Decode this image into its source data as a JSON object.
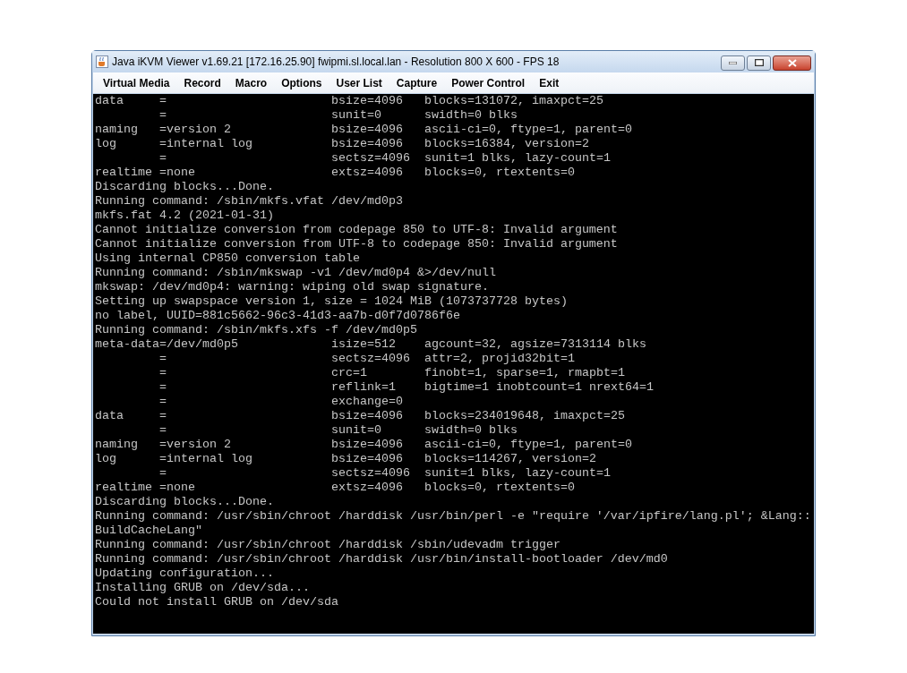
{
  "window": {
    "title": "Java iKVM Viewer v1.69.21 [172.16.25.90] fwipmi.sl.local.lan - Resolution 800 X 600 - FPS 18"
  },
  "menu": [
    "Virtual Media",
    "Record",
    "Macro",
    "Options",
    "User List",
    "Capture",
    "Power Control",
    "Exit"
  ],
  "console": [
    {
      "kind": "field",
      "label": "data",
      "value": "=",
      "param": "bsize=4096",
      "detail": "blocks=131072, imaxpct=25"
    },
    {
      "kind": "field",
      "value": "=",
      "param": "sunit=0",
      "detail": "swidth=0 blks"
    },
    {
      "kind": "field",
      "label": "naming",
      "value": "=version 2",
      "param": "bsize=4096",
      "detail": "ascii-ci=0, ftype=1, parent=0"
    },
    {
      "kind": "field",
      "label": "log",
      "value": "=internal log",
      "param": "bsize=4096",
      "detail": "blocks=16384, version=2"
    },
    {
      "kind": "field",
      "value": "=",
      "param": "sectsz=4096",
      "detail": "sunit=1 blks, lazy-count=1"
    },
    {
      "kind": "field",
      "label": "realtime",
      "value": "=none",
      "param": "extsz=4096",
      "detail": "blocks=0, rtextents=0"
    },
    {
      "kind": "text",
      "text": "Discarding blocks...Done."
    },
    {
      "kind": "text",
      "text": "Running command: /sbin/mkfs.vfat /dev/md0p3"
    },
    {
      "kind": "text",
      "text": "mkfs.fat 4.2 (2021-01-31)"
    },
    {
      "kind": "text",
      "text": "Cannot initialize conversion from codepage 850 to UTF-8: Invalid argument"
    },
    {
      "kind": "text",
      "text": "Cannot initialize conversion from UTF-8 to codepage 850: Invalid argument"
    },
    {
      "kind": "text",
      "text": "Using internal CP850 conversion table"
    },
    {
      "kind": "text",
      "text": "Running command: /sbin/mkswap -v1 /dev/md0p4 &>/dev/null"
    },
    {
      "kind": "text",
      "text": "mkswap: /dev/md0p4: warning: wiping old swap signature."
    },
    {
      "kind": "text",
      "text": "Setting up swapspace version 1, size = 1024 MiB (1073737728 bytes)"
    },
    {
      "kind": "text",
      "text": "no label, UUID=881c5662-96c3-41d3-aa7b-d0f7d0786f6e"
    },
    {
      "kind": "text",
      "text": "Running command: /sbin/mkfs.xfs -f /dev/md0p5"
    },
    {
      "kind": "field",
      "label": "meta-data",
      "value": "=/dev/md0p5",
      "param": "isize=512",
      "detail": "agcount=32, agsize=7313114 blks"
    },
    {
      "kind": "field",
      "value": "=",
      "param": "sectsz=4096",
      "detail": "attr=2, projid32bit=1"
    },
    {
      "kind": "field",
      "value": "=",
      "param": "crc=1",
      "detail": "finobt=1, sparse=1, rmapbt=1"
    },
    {
      "kind": "field",
      "value": "=",
      "param": "reflink=1",
      "detail": "bigtime=1 inobtcount=1 nrext64=1"
    },
    {
      "kind": "field",
      "value": "=",
      "param": "exchange=0"
    },
    {
      "kind": "field",
      "label": "data",
      "value": "=",
      "param": "bsize=4096",
      "detail": "blocks=234019648, imaxpct=25"
    },
    {
      "kind": "field",
      "value": "=",
      "param": "sunit=0",
      "detail": "swidth=0 blks"
    },
    {
      "kind": "field",
      "label": "naming",
      "value": "=version 2",
      "param": "bsize=4096",
      "detail": "ascii-ci=0, ftype=1, parent=0"
    },
    {
      "kind": "field",
      "label": "log",
      "value": "=internal log",
      "param": "bsize=4096",
      "detail": "blocks=114267, version=2"
    },
    {
      "kind": "field",
      "value": "=",
      "param": "sectsz=4096",
      "detail": "sunit=1 blks, lazy-count=1"
    },
    {
      "kind": "field",
      "label": "realtime",
      "value": "=none",
      "param": "extsz=4096",
      "detail": "blocks=0, rtextents=0"
    },
    {
      "kind": "text",
      "text": "Discarding blocks...Done."
    },
    {
      "kind": "text",
      "text": "Running command: /usr/sbin/chroot /harddisk /usr/bin/perl -e \"require '/var/ipfire/lang.pl'; &Lang::"
    },
    {
      "kind": "text",
      "text": "BuildCacheLang\""
    },
    {
      "kind": "text",
      "text": "Running command: /usr/sbin/chroot /harddisk /sbin/udevadm trigger"
    },
    {
      "kind": "text",
      "text": "Running command: /usr/sbin/chroot /harddisk /usr/bin/install-bootloader /dev/md0"
    },
    {
      "kind": "text",
      "text": "Updating configuration..."
    },
    {
      "kind": "text",
      "text": "Installing GRUB on /dev/sda..."
    },
    {
      "kind": "text",
      "text": "Could not install GRUB on /dev/sda"
    }
  ]
}
